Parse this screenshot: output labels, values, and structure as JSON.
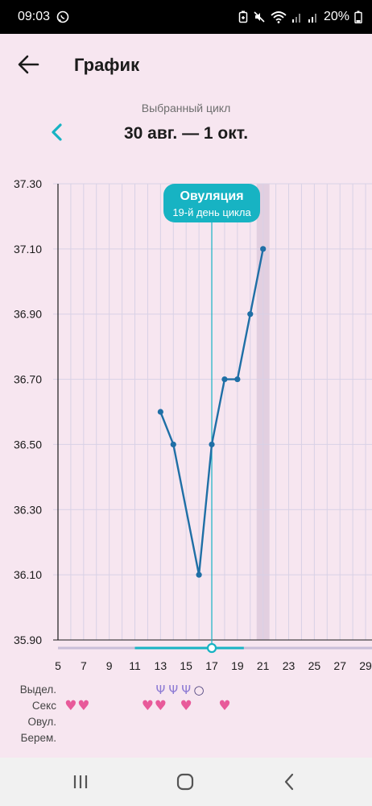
{
  "status_bar": {
    "time": "09:03",
    "battery": "20%",
    "icons": [
      "whatsapp-icon",
      "battery-saver-icon",
      "mute-icon",
      "wifi-icon",
      "signal-icon",
      "signal-icon",
      "battery-icon"
    ]
  },
  "header": {
    "title": "График",
    "back_icon": "arrow-left-icon"
  },
  "cycle": {
    "caption": "Выбранный цикл",
    "range": "30 авг. — 1 окт.",
    "prev_icon": "chevron-left-icon"
  },
  "chart_data": {
    "type": "line",
    "y_ticks": [
      "37.30",
      "37.10",
      "36.90",
      "36.70",
      "36.50",
      "36.30",
      "36.10",
      "35.90"
    ],
    "ylim": [
      35.9,
      37.3
    ],
    "x_tick_labels": [
      "5",
      "7",
      "9",
      "11",
      "13",
      "15",
      "17",
      "19",
      "21",
      "23",
      "25",
      "27",
      "29"
    ],
    "x_tick_days": [
      5,
      7,
      9,
      11,
      13,
      15,
      17,
      19,
      21,
      23,
      25,
      27,
      29
    ],
    "x_range": [
      5,
      29.5
    ],
    "grid": true,
    "series": [
      {
        "points": [
          {
            "x": 13,
            "y": 36.6
          },
          {
            "x": 14,
            "y": 36.5
          },
          {
            "x": 16,
            "y": 36.1
          },
          {
            "x": 17,
            "y": 36.5
          },
          {
            "x": 18,
            "y": 36.7
          },
          {
            "x": 19,
            "y": 36.7
          },
          {
            "x": 20,
            "y": 36.9
          },
          {
            "x": 21,
            "y": 37.1
          }
        ],
        "color": "#1f6fa6"
      }
    ],
    "ovulation": {
      "title": "Овуляция",
      "subtitle": "19-й день цикла",
      "day": 17,
      "color": "#17b3c3"
    },
    "highlight_day": 21,
    "fertile_window": [
      11,
      19.5
    ],
    "rows": [
      {
        "label": "Выдел.",
        "icons": [
          {
            "day": 13,
            "glyph": "Ψ"
          },
          {
            "day": 14,
            "glyph": "Ψ"
          },
          {
            "day": 15,
            "glyph": "Ψ"
          },
          {
            "day": 16,
            "glyph": "○"
          }
        ]
      },
      {
        "label": "Секс",
        "icons": [
          {
            "day": 6,
            "glyph": "♥"
          },
          {
            "day": 7,
            "glyph": "♥"
          },
          {
            "day": 12,
            "glyph": "♥"
          },
          {
            "day": 13,
            "glyph": "♥"
          },
          {
            "day": 15,
            "glyph": "♥"
          },
          {
            "day": 18,
            "glyph": "♥"
          }
        ]
      },
      {
        "label": "Овул.",
        "icons": []
      },
      {
        "label": "Берем.",
        "icons": []
      }
    ],
    "colors": {
      "grid": "#d8d1e6",
      "axis": "#1b1b1b",
      "highlight": "#e2cfe0",
      "discharge": "#8d7bd4",
      "heart": "#e85a9a"
    }
  },
  "nav_bar": {
    "recent_icon": "recent-apps-icon",
    "home_icon": "home-icon",
    "back_icon": "back-icon"
  }
}
